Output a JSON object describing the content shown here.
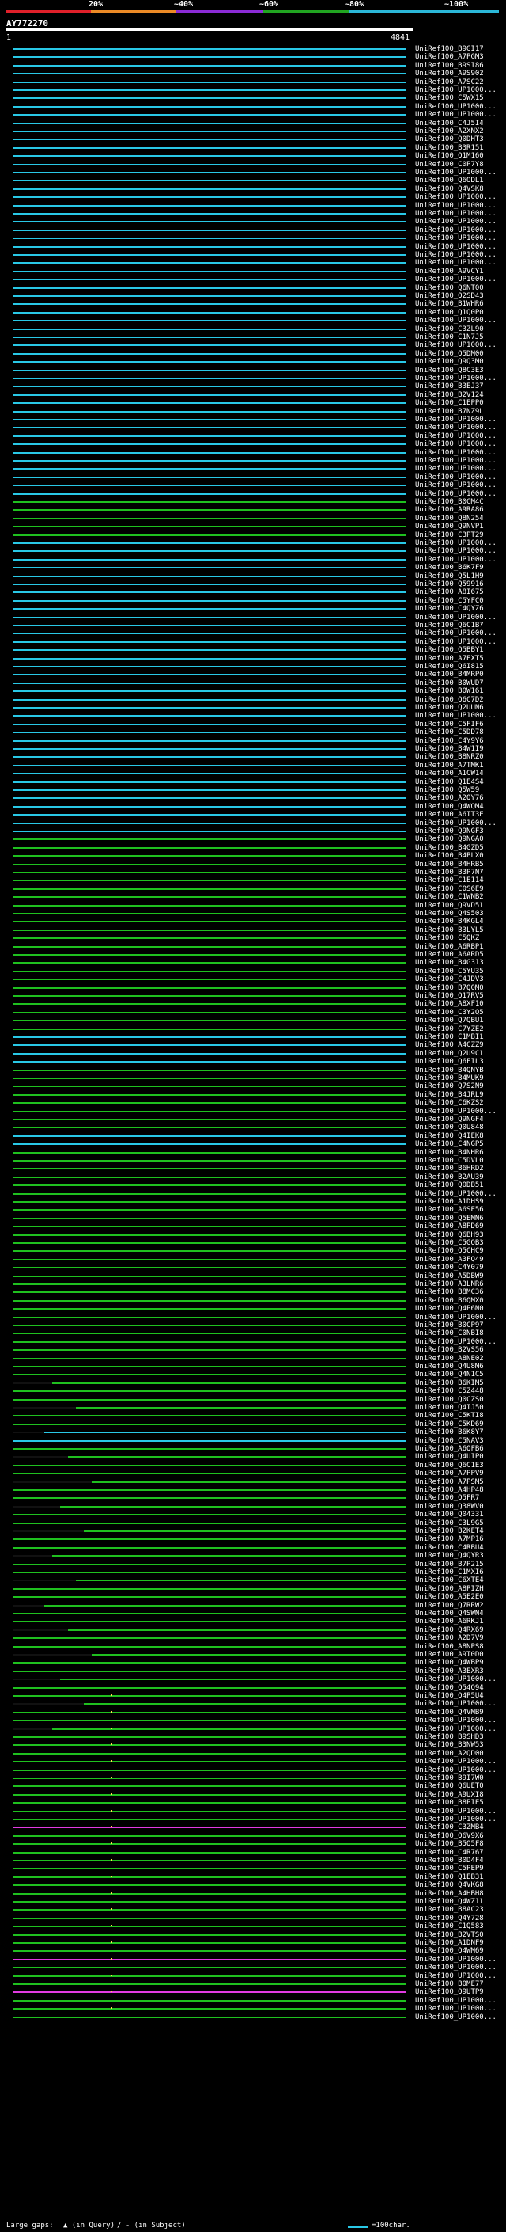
{
  "scale": {
    "percent_labels": [
      "20%",
      "~40%",
      "~60%",
      "~80%",
      "~100%"
    ],
    "colors": [
      "#e0202a",
      "#ec8a26",
      "#8b2bd6",
      "#21a521",
      "#2bb7d7"
    ]
  },
  "query": {
    "name": "AY772270",
    "start": "1",
    "end": "4841"
  },
  "legend": {
    "gap_text": "Large gaps: ",
    "query_gap": "▲ (in Query)",
    "subject_gap": "/ - (in Subject)",
    "char_scale": "=100char."
  },
  "hits": [
    {
      "label": "UniRef100_B9GI17",
      "color": "#29c8e6"
    },
    {
      "label": "UniRef100_A7PGM3",
      "color": "#29c8e6"
    },
    {
      "label": "UniRef100_B9SI86",
      "color": "#29c8e6"
    },
    {
      "label": "UniRef100_A9S902",
      "color": "#29c8e6"
    },
    {
      "label": "UniRef100_A7SC22",
      "color": "#29c8e6"
    },
    {
      "label": "UniRef100_UP1000...",
      "color": "#29c8e6"
    },
    {
      "label": "UniRef100_C5WX15",
      "color": "#29c8e6"
    },
    {
      "label": "UniRef100_UP1000...",
      "color": "#29c8e6"
    },
    {
      "label": "UniRef100_UP1000...",
      "color": "#29c8e6"
    },
    {
      "label": "UniRef100_C4J5I4",
      "color": "#29c8e6"
    },
    {
      "label": "UniRef100_A2XNX2",
      "color": "#29c8e6"
    },
    {
      "label": "UniRef100_Q0DHT3",
      "color": "#29c8e6"
    },
    {
      "label": "UniRef100_B3R151",
      "color": "#29c8e6"
    },
    {
      "label": "UniRef100_Q1M160",
      "color": "#29c8e6"
    },
    {
      "label": "UniRef100_C0P7Y8",
      "color": "#29c8e6"
    },
    {
      "label": "UniRef100_UP1000...",
      "color": "#29c8e6"
    },
    {
      "label": "UniRef100_Q6ODL1",
      "color": "#29c8e6"
    },
    {
      "label": "UniRef100_Q4VSK8",
      "color": "#29c8e6"
    },
    {
      "label": "UniRef100_UP1000...",
      "color": "#29c8e6"
    },
    {
      "label": "UniRef100_UP1000...",
      "color": "#29c8e6"
    },
    {
      "label": "UniRef100_UP1000...",
      "color": "#29c8e6"
    },
    {
      "label": "UniRef100_UP1000...",
      "color": "#29c8e6"
    },
    {
      "label": "UniRef100_UP1000...",
      "color": "#29c8e6"
    },
    {
      "label": "UniRef100_UP1000...",
      "color": "#29c8e6"
    },
    {
      "label": "UniRef100_UP1000...",
      "color": "#29c8e6"
    },
    {
      "label": "UniRef100_UP1000...",
      "color": "#29c8e6"
    },
    {
      "label": "UniRef100_UP1000...",
      "color": "#29c8e6"
    },
    {
      "label": "UniRef100_A9VCY1",
      "color": "#29c8e6"
    },
    {
      "label": "UniRef100_UP1000...",
      "color": "#29c8e6"
    },
    {
      "label": "UniRef100_Q6NT00",
      "color": "#29c8e6"
    },
    {
      "label": "UniRef100_Q2SD43",
      "color": "#29c8e6"
    },
    {
      "label": "UniRef100_B1WHR6",
      "color": "#29c8e6"
    },
    {
      "label": "UniRef100_Q1Q0P0",
      "color": "#29c8e6"
    },
    {
      "label": "UniRef100_UP1000...",
      "color": "#29c8e6"
    },
    {
      "label": "UniRef100_C3ZL90",
      "color": "#29c8e6"
    },
    {
      "label": "UniRef100_C1N7J5",
      "color": "#29c8e6"
    },
    {
      "label": "UniRef100_UP1000...",
      "color": "#29c8e6"
    },
    {
      "label": "UniRef100_Q5DM00",
      "color": "#29c8e6"
    },
    {
      "label": "UniRef100_Q9Q3M0",
      "color": "#29c8e6"
    },
    {
      "label": "UniRef100_Q8C3E3",
      "color": "#29c8e6"
    },
    {
      "label": "UniRef100_UP1000...",
      "color": "#29c8e6"
    },
    {
      "label": "UniRef100_B3EJ37",
      "color": "#29c8e6"
    },
    {
      "label": "UniRef100_B2V124",
      "color": "#29c8e6"
    },
    {
      "label": "UniRef100_C1EPP0",
      "color": "#29c8e6"
    },
    {
      "label": "UniRef100_B7NZ9L",
      "color": "#29c8e6"
    },
    {
      "label": "UniRef100_UP1000...",
      "color": "#29c8e6"
    },
    {
      "label": "UniRef100_UP1000...",
      "color": "#29c8e6"
    },
    {
      "label": "UniRef100_UP1000...",
      "color": "#29c8e6"
    },
    {
      "label": "UniRef100_UP1000...",
      "color": "#29c8e6"
    },
    {
      "label": "UniRef100_UP1000...",
      "color": "#29c8e6"
    },
    {
      "label": "UniRef100_UP1000...",
      "color": "#29c8e6"
    },
    {
      "label": "UniRef100_UP1000...",
      "color": "#29c8e6"
    },
    {
      "label": "UniRef100_UP1000...",
      "color": "#29c8e6"
    },
    {
      "label": "UniRef100_UP1000...",
      "color": "#29c8e6"
    },
    {
      "label": "UniRef100_UP1000...",
      "color": "#29c8e6"
    },
    {
      "label": "UniRef100_B0CM4C",
      "color": "#29c8e6"
    },
    {
      "label": "UniRef100_A9RA86",
      "color": "#29c8e6"
    },
    {
      "label": "UniRef100_Q8N254",
      "color": "#29c8e6"
    },
    {
      "label": "UniRef100_Q9NVP1",
      "color": "#29c8e6"
    },
    {
      "label": "UniRef100_C3PT29",
      "color": "#29c8e6"
    },
    {
      "label": "UniRef100_UP1000...",
      "color": "#29c8e6"
    },
    {
      "label": "UniRef100_UP1000...",
      "color": "#29c8e6"
    },
    {
      "label": "UniRef100_UP1000...",
      "color": "#29c8e6"
    },
    {
      "label": "UniRef100_B6K7F9",
      "color": "#29c8e6"
    },
    {
      "label": "UniRef100_Q5L1H9",
      "color": "#29c8e6"
    },
    {
      "label": "UniRef100_Q59916",
      "color": "#29c8e6"
    },
    {
      "label": "UniRef100_A8I675",
      "color": "#29c8e6"
    },
    {
      "label": "UniRef100_C5YFC0",
      "color": "#29c8e6"
    },
    {
      "label": "UniRef100_C4QYZ6",
      "color": "#29c8e6"
    },
    {
      "label": "UniRef100_UP1000...",
      "color": "#29c8e6"
    },
    {
      "label": "UniRef100_Q6C1B7",
      "color": "#29c8e6"
    },
    {
      "label": "UniRef100_UP1000...",
      "color": "#29c8e6"
    },
    {
      "label": "UniRef100_UP1000...",
      "color": "#29c8e6"
    },
    {
      "label": "UniRef100_Q5BBY1",
      "color": "#29c8e6"
    },
    {
      "label": "UniRef100_A7EXT5",
      "color": "#29c8e6"
    },
    {
      "label": "UniRef100_Q6I815",
      "color": "#29c8e6"
    },
    {
      "label": "UniRef100_B4MRP0",
      "color": "#29c8e6"
    },
    {
      "label": "UniRef100_B0WUD7",
      "color": "#29c8e6"
    },
    {
      "label": "UniRef100_B0W161",
      "color": "#29c8e6"
    },
    {
      "label": "UniRef100_Q6C7D2",
      "color": "#29c8e6"
    },
    {
      "label": "UniRef100_Q2UUN6",
      "color": "#29c8e6"
    },
    {
      "label": "UniRef100_UP1000...",
      "color": "#29c8e6"
    },
    {
      "label": "UniRef100_C5FIF6",
      "color": "#29c8e6"
    },
    {
      "label": "UniRef100_C5DD78",
      "color": "#29c8e6"
    },
    {
      "label": "UniRef100_C4Y9Y6",
      "color": "#29c8e6"
    },
    {
      "label": "UniRef100_B4W1I9",
      "color": "#29c8e6"
    },
    {
      "label": "UniRef100_B8NRZ0",
      "color": "#29c8e6"
    },
    {
      "label": "UniRef100_A7TMK1",
      "color": "#29c8e6"
    },
    {
      "label": "UniRef100_A1CW14",
      "color": "#29c8e6"
    },
    {
      "label": "UniRef100_Q1E4S4",
      "color": "#29c8e6"
    },
    {
      "label": "UniRef100_Q5W59",
      "color": "#29c8e6"
    },
    {
      "label": "UniRef100_A2QY76",
      "color": "#29c8e6"
    },
    {
      "label": "UniRef100_Q4WQM4",
      "color": "#29c8e6"
    },
    {
      "label": "UniRef100_A6IT3E",
      "color": "#29c8e6"
    },
    {
      "label": "UniRef100_UP1000...",
      "color": "#29c8e6"
    },
    {
      "label": "UniRef100_Q9NGF3",
      "color": "#29c8e6"
    },
    {
      "label": "UniRef100_Q9NGA0",
      "color": "#29c8e6"
    },
    {
      "label": "UniRef100_B4GZD5",
      "color": "#29c8e6"
    },
    {
      "label": "UniRef100_B4PLX0",
      "color": "#29c8e6"
    },
    {
      "label": "UniRef100_B4HRB5",
      "color": "#29c8e6"
    },
    {
      "label": "UniRef100_B3P7N7",
      "color": "#29c8e6"
    },
    {
      "label": "UniRef100_C1E114",
      "color": "#29c8e6"
    },
    {
      "label": "UniRef100_C0S6E9",
      "color": "#29c8e6"
    },
    {
      "label": "UniRef100_C1WNB2",
      "color": "#29c8e6"
    },
    {
      "label": "UniRef100_Q9VD51",
      "color": "#29c8e6"
    },
    {
      "label": "UniRef100_Q4S503",
      "color": "#29c8e6"
    },
    {
      "label": "UniRef100_B4KGL4",
      "color": "#29c8e6"
    },
    {
      "label": "UniRef100_B3LYL5",
      "color": "#29c8e6"
    },
    {
      "label": "UniRef100_C5QKZ",
      "color": "#29c8e6"
    },
    {
      "label": "UniRef100_A6RBP1",
      "color": "#29c8e6"
    },
    {
      "label": "UniRef100_A6ARD5",
      "color": "#29c8e6"
    },
    {
      "label": "UniRef100_B4G313",
      "color": "#29c8e6"
    },
    {
      "label": "UniRef100_C5YU35",
      "color": "#29c8e6"
    },
    {
      "label": "UniRef100_C4JDV3",
      "color": "#29c8e6"
    },
    {
      "label": "UniRef100_B7Q0M0",
      "color": "#29c8e6"
    },
    {
      "label": "UniRef100_Q17RV5",
      "color": "#29c8e6"
    },
    {
      "label": "UniRef100_A8XF10",
      "color": "#29c8e6"
    },
    {
      "label": "UniRef100_C3Y2Q5",
      "color": "#29c8e6"
    },
    {
      "label": "UniRef100_Q7QBU1",
      "color": "#29c8e6"
    },
    {
      "label": "UniRef100_C7YZE2",
      "color": "#29c8e6"
    },
    {
      "label": "UniRef100_C1MBI1",
      "color": "#29c8e6"
    },
    {
      "label": "UniRef100_A4CZZ9",
      "color": "#29c8e6"
    },
    {
      "label": "UniRef100_Q2U9C1",
      "color": "#29c8e6"
    },
    {
      "label": "UniRef100_Q6FIL3",
      "color": "#29c8e6"
    },
    {
      "label": "UniRef100_B4QNYB",
      "color": "#29c8e6"
    },
    {
      "label": "UniRef100_B4MUK9",
      "color": "#29c8e6"
    },
    {
      "label": "UniRef100_Q7S2N9",
      "color": "#29c8e6"
    },
    {
      "label": "UniRef100_B4JRL9",
      "color": "#29c8e6"
    },
    {
      "label": "UniRef100_C6KZS2",
      "color": "#29c8e6"
    },
    {
      "label": "UniRef100_UP1000...",
      "color": "#29c8e6"
    },
    {
      "label": "UniRef100_Q9NGF4",
      "color": "#29c8e6"
    },
    {
      "label": "UniRef100_Q0U848",
      "color": "#29c8e6"
    },
    {
      "label": "UniRef100_Q4IEK8",
      "color": "#29c8e6"
    },
    {
      "label": "UniRef100_C4NGP5",
      "color": "#29c8e6"
    },
    {
      "label": "UniRef100_B4NHR6",
      "color": "#29c8e6"
    },
    {
      "label": "UniRef100_C5DVL0",
      "color": "#29c8e6"
    },
    {
      "label": "UniRef100_B6HRD2",
      "color": "#29c8e6"
    },
    {
      "label": "UniRef100_B2AU39",
      "color": "#29c8e6"
    },
    {
      "label": "UniRef100_Q0DB51",
      "color": "#29c8e6"
    },
    {
      "label": "UniRef100_UP1000...",
      "color": "#29c8e6"
    },
    {
      "label": "UniRef100_A1DHS9",
      "color": "#29c8e6"
    },
    {
      "label": "UniRef100_A6SE56",
      "color": "#29c8e6"
    },
    {
      "label": "UniRef100_Q5EMN6",
      "color": "#29c8e6"
    },
    {
      "label": "UniRef100_A8PD69",
      "color": "#29c8e6"
    },
    {
      "label": "UniRef100_Q6BH93",
      "color": "#29c8e6"
    },
    {
      "label": "UniRef100_C5GOB3",
      "color": "#29c8e6"
    },
    {
      "label": "UniRef100_Q5CHC9",
      "color": "#29c8e6"
    },
    {
      "label": "UniRef100_A3FQ49",
      "color": "#29c8e6"
    },
    {
      "label": "UniRef100_C4Y079",
      "color": "#29c8e6"
    },
    {
      "label": "UniRef100_A5DBW9",
      "color": "#29c8e6"
    },
    {
      "label": "UniRef100_A3LNR6",
      "color": "#29c8e6"
    },
    {
      "label": "UniRef100_B8MC36",
      "color": "#29c8e6"
    },
    {
      "label": "UniRef100_B6QMX0",
      "color": "#29c8e6"
    },
    {
      "label": "UniRef100_Q4P6N0",
      "color": "#29c8e6"
    },
    {
      "label": "UniRef100_UP1000...",
      "color": "#29c8e6"
    },
    {
      "label": "UniRef100_B0CP97",
      "color": "#29c8e6"
    },
    {
      "label": "UniRef100_C0NBI8",
      "color": "#29c8e6"
    },
    {
      "label": "UniRef100_UP1000...",
      "color": "#29c8e6"
    },
    {
      "label": "UniRef100_B2VS56",
      "color": "#29c8e6"
    },
    {
      "label": "UniRef100_A8NE02",
      "color": "#29c8e6"
    },
    {
      "label": "UniRef100_Q4U8M6",
      "color": "#29c8e6"
    },
    {
      "label": "UniRef100_Q4N1C5",
      "color": "#29c8e6"
    },
    {
      "label": "UniRef100_B6KIM5",
      "color": "#29c8e6"
    },
    {
      "label": "UniRef100_C5Z448",
      "color": "#29c8e6"
    },
    {
      "label": "UniRef100_Q0CZS0",
      "color": "#29c8e6"
    },
    {
      "label": "UniRef100_Q4IJ50",
      "color": "#29c8e6"
    },
    {
      "label": "UniRef100_C5KTI8",
      "color": "#29c8e6"
    },
    {
      "label": "UniRef100_C5KD69",
      "color": "#29c8e6"
    },
    {
      "label": "UniRef100_B6K8Y7",
      "color": "#29c8e6"
    },
    {
      "label": "UniRef100_C5NAV3",
      "color": "#29c8e6"
    },
    {
      "label": "UniRef100_A6QFB6",
      "color": "#29c8e6"
    },
    {
      "label": "UniRef100_Q4UIP0",
      "color": "#29c8e6"
    },
    {
      "label": "UniRef100_Q6C1E3",
      "color": "#29c8e6"
    },
    {
      "label": "UniRef100_A7PPV9",
      "color": "#29c8e6"
    },
    {
      "label": "UniRef100_A7PSM5",
      "color": "#29c8e6"
    },
    {
      "label": "UniRef100_A4HP48",
      "color": "#29c8e6"
    },
    {
      "label": "UniRef100_Q5FR7",
      "color": "#29c8e6"
    },
    {
      "label": "UniRef100_Q38WV0",
      "color": "#29c8e6"
    },
    {
      "label": "UniRef100_Q04331",
      "color": "#29c8e6"
    },
    {
      "label": "UniRef100_C3L9G5",
      "color": "#29c8e6"
    },
    {
      "label": "UniRef100_B2KET4",
      "color": "#29c8e6"
    },
    {
      "label": "UniRef100_A7MP16",
      "color": "#29c8e6"
    },
    {
      "label": "UniRef100_C4RBU4",
      "color": "#29c8e6"
    },
    {
      "label": "UniRef100_Q4QYR3",
      "color": "#29c8e6"
    },
    {
      "label": "UniRef100_B7P215",
      "color": "#29c8e6"
    },
    {
      "label": "UniRef100_C1MXI6",
      "color": "#29c8e6"
    },
    {
      "label": "UniRef100_C6XTE4",
      "color": "#29c8e6"
    },
    {
      "label": "UniRef100_A8PIZH",
      "color": "#29c8e6"
    },
    {
      "label": "UniRef100_A5E2E0",
      "color": "#29c8e6"
    },
    {
      "label": "UniRef100_Q7RRW2",
      "color": "#29c8e6"
    },
    {
      "label": "UniRef100_Q4SWN4",
      "color": "#29c8e6"
    },
    {
      "label": "UniRef100_A6RKJ1",
      "color": "#29c8e6"
    },
    {
      "label": "UniRef100_Q4RX69",
      "color": "#29c8e6"
    },
    {
      "label": "UniRef100_A2D7V9",
      "color": "#29c8e6"
    },
    {
      "label": "UniRef100_A8NPS8",
      "color": "#29c8e6"
    },
    {
      "label": "UniRef100_A9T0D0",
      "color": "#29c8e6"
    },
    {
      "label": "UniRef100_Q4WBP9",
      "color": "#29c8e6"
    },
    {
      "label": "UniRef100_A3EXR3",
      "color": "#29c8e6"
    },
    {
      "label": "UniRef100_UP1000...",
      "color": "#29c8e6"
    },
    {
      "label": "UniRef100_Q54Q94",
      "color": "#29c8e6"
    },
    {
      "label": "UniRef100_Q4P5U4",
      "color": "#29c8e6"
    },
    {
      "label": "UniRef100_UP1000...",
      "color": "#29c8e6"
    },
    {
      "label": "UniRef100_Q4VMB9",
      "color": "#29c8e6"
    },
    {
      "label": "UniRef100_UP1000...",
      "color": "#29c8e6"
    },
    {
      "label": "UniRef100_UP1000...",
      "color": "#29c8e6"
    },
    {
      "label": "UniRef100_B9SHD3",
      "color": "#29c8e6"
    },
    {
      "label": "UniRef100_B3NW53",
      "color": "#29c8e6"
    },
    {
      "label": "UniRef100_A2QD00",
      "color": "#29c8e6"
    },
    {
      "label": "UniRef100_UP1000...",
      "color": "#29c8e6"
    },
    {
      "label": "UniRef100_UP1000...",
      "color": "#29c8e6"
    },
    {
      "label": "UniRef100_B9I7W0",
      "color": "#29c8e6"
    },
    {
      "label": "UniRef100_Q6UET0",
      "color": "#29c8e6"
    },
    {
      "label": "UniRef100_A9UXI8",
      "color": "#29c8e6"
    },
    {
      "label": "UniRef100_B8PIE5",
      "color": "#29c8e6"
    },
    {
      "label": "UniRef100_UP1000...",
      "color": "#29c8e6"
    },
    {
      "label": "UniRef100_UP1000...",
      "color": "#29c8e6"
    },
    {
      "label": "UniRef100_C3ZMB4",
      "color": "#29c8e6"
    },
    {
      "label": "UniRef100_Q6V9X6",
      "color": "#29c8e6"
    },
    {
      "label": "UniRef100_B5Q5F8",
      "color": "#29c8e6"
    },
    {
      "label": "UniRef100_C4R767",
      "color": "#29c8e6"
    },
    {
      "label": "UniRef100_B0D4F4",
      "color": "#29c8e6"
    },
    {
      "label": "UniRef100_C5PEP9",
      "color": "#29c8e6"
    },
    {
      "label": "UniRef100_Q1EB31",
      "color": "#29c8e6"
    },
    {
      "label": "UniRef100_Q4VKG8",
      "color": "#29c8e6"
    },
    {
      "label": "UniRef100_A4HBH8",
      "color": "#29c8e6"
    },
    {
      "label": "UniRef100_Q4WZ11",
      "color": "#29c8e6"
    },
    {
      "label": "UniRef100_B8AC23",
      "color": "#29c8e6"
    },
    {
      "label": "UniRef100_Q4Y728",
      "color": "#29c8e6"
    },
    {
      "label": "UniRef100_C1Q583",
      "color": "#29c8e6"
    },
    {
      "label": "UniRef100_B2VTS0",
      "color": "#29c8e6"
    },
    {
      "label": "UniRef100_A1DNF9",
      "color": "#29c8e6"
    },
    {
      "label": "UniRef100_Q4WM69",
      "color": "#29c8e6"
    },
    {
      "label": "UniRef100_UP1000...",
      "color": "#29c8e6"
    },
    {
      "label": "UniRef100_UP1000...",
      "color": "#29c8e6"
    },
    {
      "label": "UniRef100_UP1000...",
      "color": "#29c8e6"
    },
    {
      "label": "UniRef100_B0ME77",
      "color": "#29c8e6"
    },
    {
      "label": "UniRef100_Q9UTP9",
      "color": "#29c8e6"
    },
    {
      "label": "UniRef100_UP1000...",
      "color": "#29c8e6"
    },
    {
      "label": "UniRef100_UP1000...",
      "color": "#29c8e6"
    },
    {
      "label": "UniRef100_UP1000...",
      "color": "#29c8e6"
    }
  ]
}
